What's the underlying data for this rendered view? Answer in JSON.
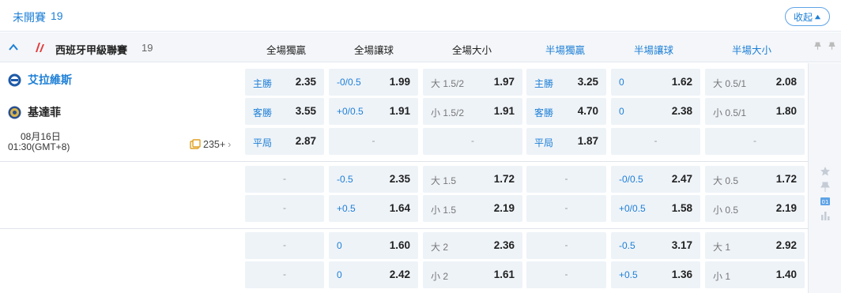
{
  "topbar": {
    "title": "未開賽",
    "count": "19",
    "collapse_label": "收起"
  },
  "header": {
    "league": "西班牙甲級聯賽",
    "league_count": "19",
    "columns": [
      "全場獨贏",
      "全場讓球",
      "全場大小",
      "半場獨贏",
      "半場讓球",
      "半場大小"
    ]
  },
  "match": {
    "home": "艾拉維斯",
    "away": "基達菲",
    "date": "08月16日",
    "time": "01:30(GMT+8)",
    "more": "235+"
  },
  "odds": {
    "r1": {
      "a": [
        "主勝",
        "2.35",
        "客勝",
        "3.55",
        "平局",
        "2.87"
      ],
      "b": [
        "-0/0.5",
        "1.99",
        "+0/0.5",
        "1.91",
        "-",
        ""
      ],
      "c": [
        "大 1.5/2",
        "1.97",
        "小 1.5/2",
        "1.91",
        "-",
        ""
      ],
      "d": [
        "主勝",
        "3.25",
        "客勝",
        "4.70",
        "平局",
        "1.87"
      ],
      "e": [
        "0",
        "1.62",
        "0",
        "2.38",
        "-",
        ""
      ],
      "f": [
        "大 0.5/1",
        "2.08",
        "小 0.5/1",
        "1.80",
        "-",
        ""
      ]
    },
    "r2": {
      "a": [
        "-",
        "",
        "-",
        ""
      ],
      "b": [
        "-0.5",
        "2.35",
        "+0.5",
        "1.64"
      ],
      "c": [
        "大 1.5",
        "1.72",
        "小 1.5",
        "2.19"
      ],
      "d": [
        "-",
        "",
        "-",
        ""
      ],
      "e": [
        "-0/0.5",
        "2.47",
        "+0/0.5",
        "1.58"
      ],
      "f": [
        "大 0.5",
        "1.72",
        "小 0.5",
        "2.19"
      ]
    },
    "r3": {
      "a": [
        "-",
        "",
        "-",
        ""
      ],
      "b": [
        "0",
        "1.60",
        "0",
        "2.42"
      ],
      "c": [
        "大 2",
        "2.36",
        "小 2",
        "1.61"
      ],
      "d": [
        "-",
        "",
        "-",
        ""
      ],
      "e": [
        "-0.5",
        "3.17",
        "+0.5",
        "1.36"
      ],
      "f": [
        "大 1",
        "2.92",
        "小 1",
        "1.40"
      ]
    }
  },
  "colors": {
    "accent": "#1d7fd6",
    "cell_bg": "#eef3f8"
  },
  "icons": [
    "chevron-up-icon",
    "league-logo-icon",
    "star-icon",
    "pin-icon",
    "stats-icon",
    "bar-chart-icon"
  ]
}
